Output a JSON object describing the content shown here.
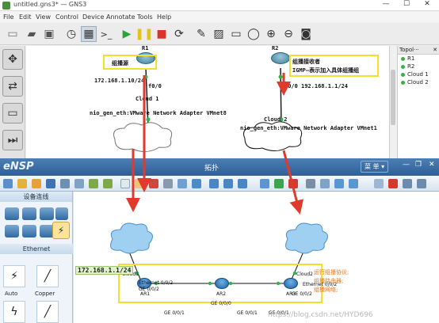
{
  "gns3": {
    "title": "untitled.gns3* — GNS3",
    "menu": [
      "File",
      "Edit",
      "View",
      "Control",
      "Device",
      "Annotate",
      "Tools",
      "Help"
    ],
    "topology_panel": {
      "header": "Topol···",
      "nodes": [
        "R1",
        "R2",
        "Cloud 1",
        "Cloud 2"
      ]
    },
    "canvas": {
      "r1_label": "R1",
      "r2_label": "R2",
      "r1_note": "组播源",
      "r2_note_line1": "组播接收者",
      "r2_note_line2": "IGMP—表示加入具体组播组",
      "r1_ip": "172.168.1.10/24",
      "r2_ip": "192.168.1.1/24",
      "r1_if": "f0/0",
      "r2_if": "f0/0",
      "cloud1_label": "Cloud 1",
      "cloud2_label": "Cloud 2",
      "cloud1_adapter": "nio_gen_eth:VMware Network Adapter VMnet8",
      "cloud2_adapter": "nio_gen_eth:VMware Network Adapter VMnet1"
    }
  },
  "ensp": {
    "logo": "eNSP",
    "center_title": "拓扑",
    "menu_label": "菜 单 ▾",
    "left_panel": {
      "section1": "设备连线",
      "section2": "Ethernet",
      "cable1": "Auto",
      "cable2": "Copper"
    },
    "canvas": {
      "cloud1": "Cloud1",
      "cloud2": "Cloud2",
      "ar1": "AR1",
      "ar2": "AR2",
      "ar3": "AR3",
      "c1_if1": "Ethernet 0/0/2",
      "c1_if2": "GE 0/0/2",
      "c2_if1": "Ethernet 0/0/2",
      "c2_if2": "GE 0/0/2",
      "ar1_ar2_left": "GE 0/0/1",
      "ar1_ar2_top": "GE 0/0/0",
      "ar2_ar3_left": "GE 0/0/1",
      "ar2_ar3_right": "GE 0/0/1",
      "ip_label": "172.168.1.1/24",
      "note_line1": "运行组播协议;",
      "note_line2": "组播路由器;",
      "note_line3": "组播网络;",
      "watermark": "https://blog.csdn.net/HYD696"
    }
  }
}
